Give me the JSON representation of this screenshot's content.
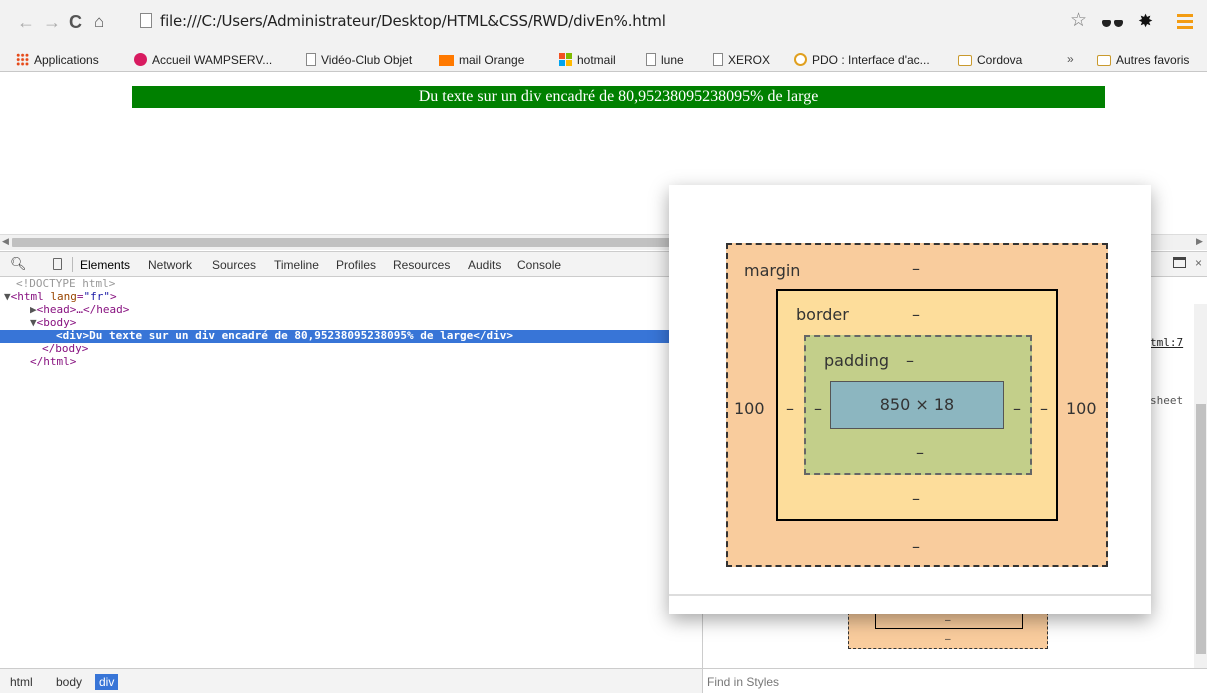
{
  "toolbar": {
    "url": "file:///C:/Users/Administrateur/Desktop/HTML&CSS/RWD/divEn%.html",
    "back_icon": "back-arrow-icon",
    "forward_icon": "forward-arrow-icon",
    "reload_icon": "reload-icon",
    "home_icon": "home-icon"
  },
  "bookmarks": {
    "items": [
      {
        "label": "Applications",
        "icon": "apps-grid-icon"
      },
      {
        "label": "Accueil WAMPSERV...",
        "icon": "wamp-icon"
      },
      {
        "label": "Vidéo-Club Objet",
        "icon": "page-icon"
      },
      {
        "label": "mail Orange",
        "icon": "orange-icon"
      },
      {
        "label": "hotmail",
        "icon": "windows-icon"
      },
      {
        "label": "lune",
        "icon": "page-icon"
      },
      {
        "label": "XEROX",
        "icon": "page-icon"
      },
      {
        "label": "PDO : Interface d'ac...",
        "icon": "pdo-icon"
      },
      {
        "label": "Cordova",
        "icon": "folder-icon"
      }
    ],
    "more": "»",
    "other_favorites": "Autres favoris"
  },
  "page": {
    "green_text": "Du texte sur un div encadré de 80,95238095238095% de large",
    "green_color": "#008000"
  },
  "devtools": {
    "tabs": [
      "Elements",
      "Network",
      "Sources",
      "Timeline",
      "Profiles",
      "Resources",
      "Audits",
      "Console"
    ],
    "active_tab": "Elements",
    "dom": {
      "doctype": "<!DOCTYPE html>",
      "html_open_tag": "<html",
      "html_attr_name": "lang",
      "html_attr_value": "\"fr\"",
      "head_line": "<head>…</head>",
      "body_open": "<body>",
      "div_line": "<div>Du texte sur un div encadré de 80,95238095238095% de large</div>",
      "body_close": "</body>",
      "html_close": "</html>"
    },
    "breadcrumbs": [
      "html",
      "body",
      "div"
    ],
    "active_crumb": "div",
    "style_link": "tml:7",
    "style_link2": "sheet",
    "find_in_styles": "Find in Styles"
  },
  "box_model": {
    "margin_label": "margin",
    "border_label": "border",
    "padding_label": "padding",
    "margin_top": "–",
    "margin_bottom": "–",
    "margin_left": "100",
    "margin_right": "100",
    "border_top": "–",
    "border_bottom": "–",
    "border_left": "–",
    "border_right": "–",
    "padding_top": "–",
    "padding_bottom": "–",
    "padding_left": "–",
    "padding_right": "–",
    "content": "850 × 18",
    "colors": {
      "margin": "#f9cc9d",
      "border": "#fddd9b",
      "padding": "#c3cf8a",
      "content": "#8cb6c0"
    }
  },
  "mini_box": {
    "dash1": "–",
    "dash2": "–"
  }
}
